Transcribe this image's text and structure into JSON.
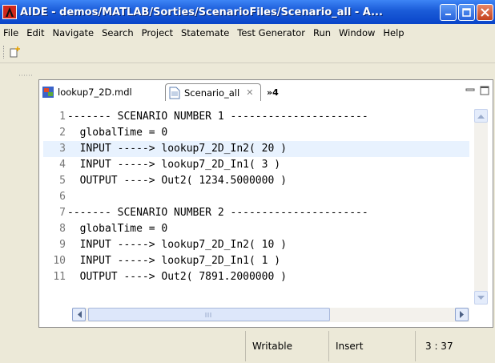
{
  "window": {
    "title": "AIDE - demos/MATLAB/Sorties/ScenarioFiles/Scenario_all - A..."
  },
  "menu": [
    "File",
    "Edit",
    "Navigate",
    "Search",
    "Project",
    "Statemate",
    "Test Generator",
    "Run",
    "Window",
    "Help"
  ],
  "tabs": {
    "tab1_label": "lookup7_2D.mdl",
    "tab2_label": "Scenario_all",
    "tab2_close": "✕",
    "overflow_label": "»4"
  },
  "editor": {
    "lines": [
      {
        "num": "1",
        "text": "------- SCENARIO NUMBER 1 ----------------------"
      },
      {
        "num": "2",
        "text": "  globalTime = 0"
      },
      {
        "num": "3",
        "text": "  INPUT -----> lookup7_2D_In2( 20 )"
      },
      {
        "num": "4",
        "text": "  INPUT -----> lookup7_2D_In1( 3 )"
      },
      {
        "num": "5",
        "text": "  OUTPUT ----> Out2( 1234.5000000 )"
      },
      {
        "num": "6",
        "text": ""
      },
      {
        "num": "7",
        "text": "------- SCENARIO NUMBER 2 ----------------------"
      },
      {
        "num": "8",
        "text": "  globalTime = 0"
      },
      {
        "num": "9",
        "text": "  INPUT -----> lookup7_2D_In2( 10 )"
      },
      {
        "num": "10",
        "text": "  INPUT -----> lookup7_2D_In1( 1 )"
      },
      {
        "num": "11",
        "text": "  OUTPUT ----> Out2( 7891.2000000 )"
      }
    ],
    "highlighted_line": 3
  },
  "statusbar": {
    "mode": "Writable",
    "insert": "Insert",
    "position": "3 : 37"
  },
  "colors": {
    "titlebar": "#0a45c9",
    "line_highlight": "#e8f2fe",
    "chrome": "#ece9d8"
  }
}
